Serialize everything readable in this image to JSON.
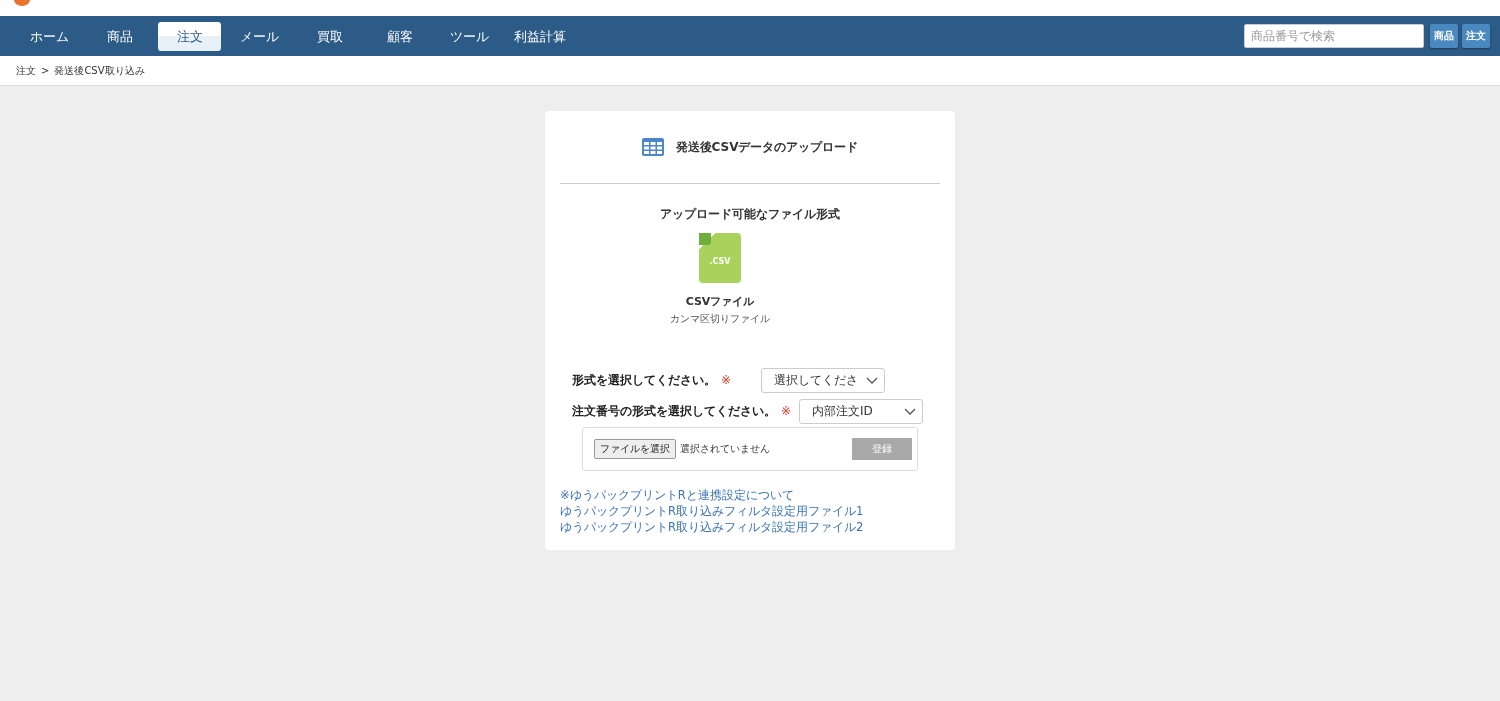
{
  "nav": {
    "items": [
      {
        "label": "ホーム",
        "selected": false
      },
      {
        "label": "商品",
        "selected": false
      },
      {
        "label": "注文",
        "selected": true
      },
      {
        "label": "メール",
        "selected": false
      },
      {
        "label": "買取",
        "selected": false
      },
      {
        "label": "顧客",
        "selected": false
      },
      {
        "label": "ツール",
        "selected": false
      },
      {
        "label": "利益計算",
        "selected": false
      }
    ],
    "search": {
      "placeholder": "商品番号で検索"
    },
    "search_buttons": [
      "商品",
      "注文"
    ]
  },
  "breadcrumb": {
    "items": [
      "注文",
      "発送後CSV取り込み"
    ],
    "separator": ">"
  },
  "card": {
    "title": "発送後CSVデータのアップロード",
    "formats_heading": "アップロード可能なファイル形式",
    "file_type": {
      "badge": ".CSV",
      "name": "CSVファイル",
      "description": "カンマ区切りファイル"
    },
    "fields": [
      {
        "label": "形式を選択してください。",
        "required_mark": "※",
        "value": "選択してくださ"
      },
      {
        "label": "注文番号の形式を選択してください。",
        "required_mark": "※",
        "value": "内部注文ID"
      }
    ],
    "file_input": {
      "button": "ファイルを選択",
      "status": "選択されていません"
    },
    "submit": {
      "label": "登録",
      "disabled": true
    },
    "links": [
      "※ゆうパックプリントRと連携設定について",
      "ゆうパックプリントR取り込みフィルタ設定用ファイル1",
      "ゆうパックプリントR取り込みフィルタ設定用ファイル2"
    ]
  }
}
